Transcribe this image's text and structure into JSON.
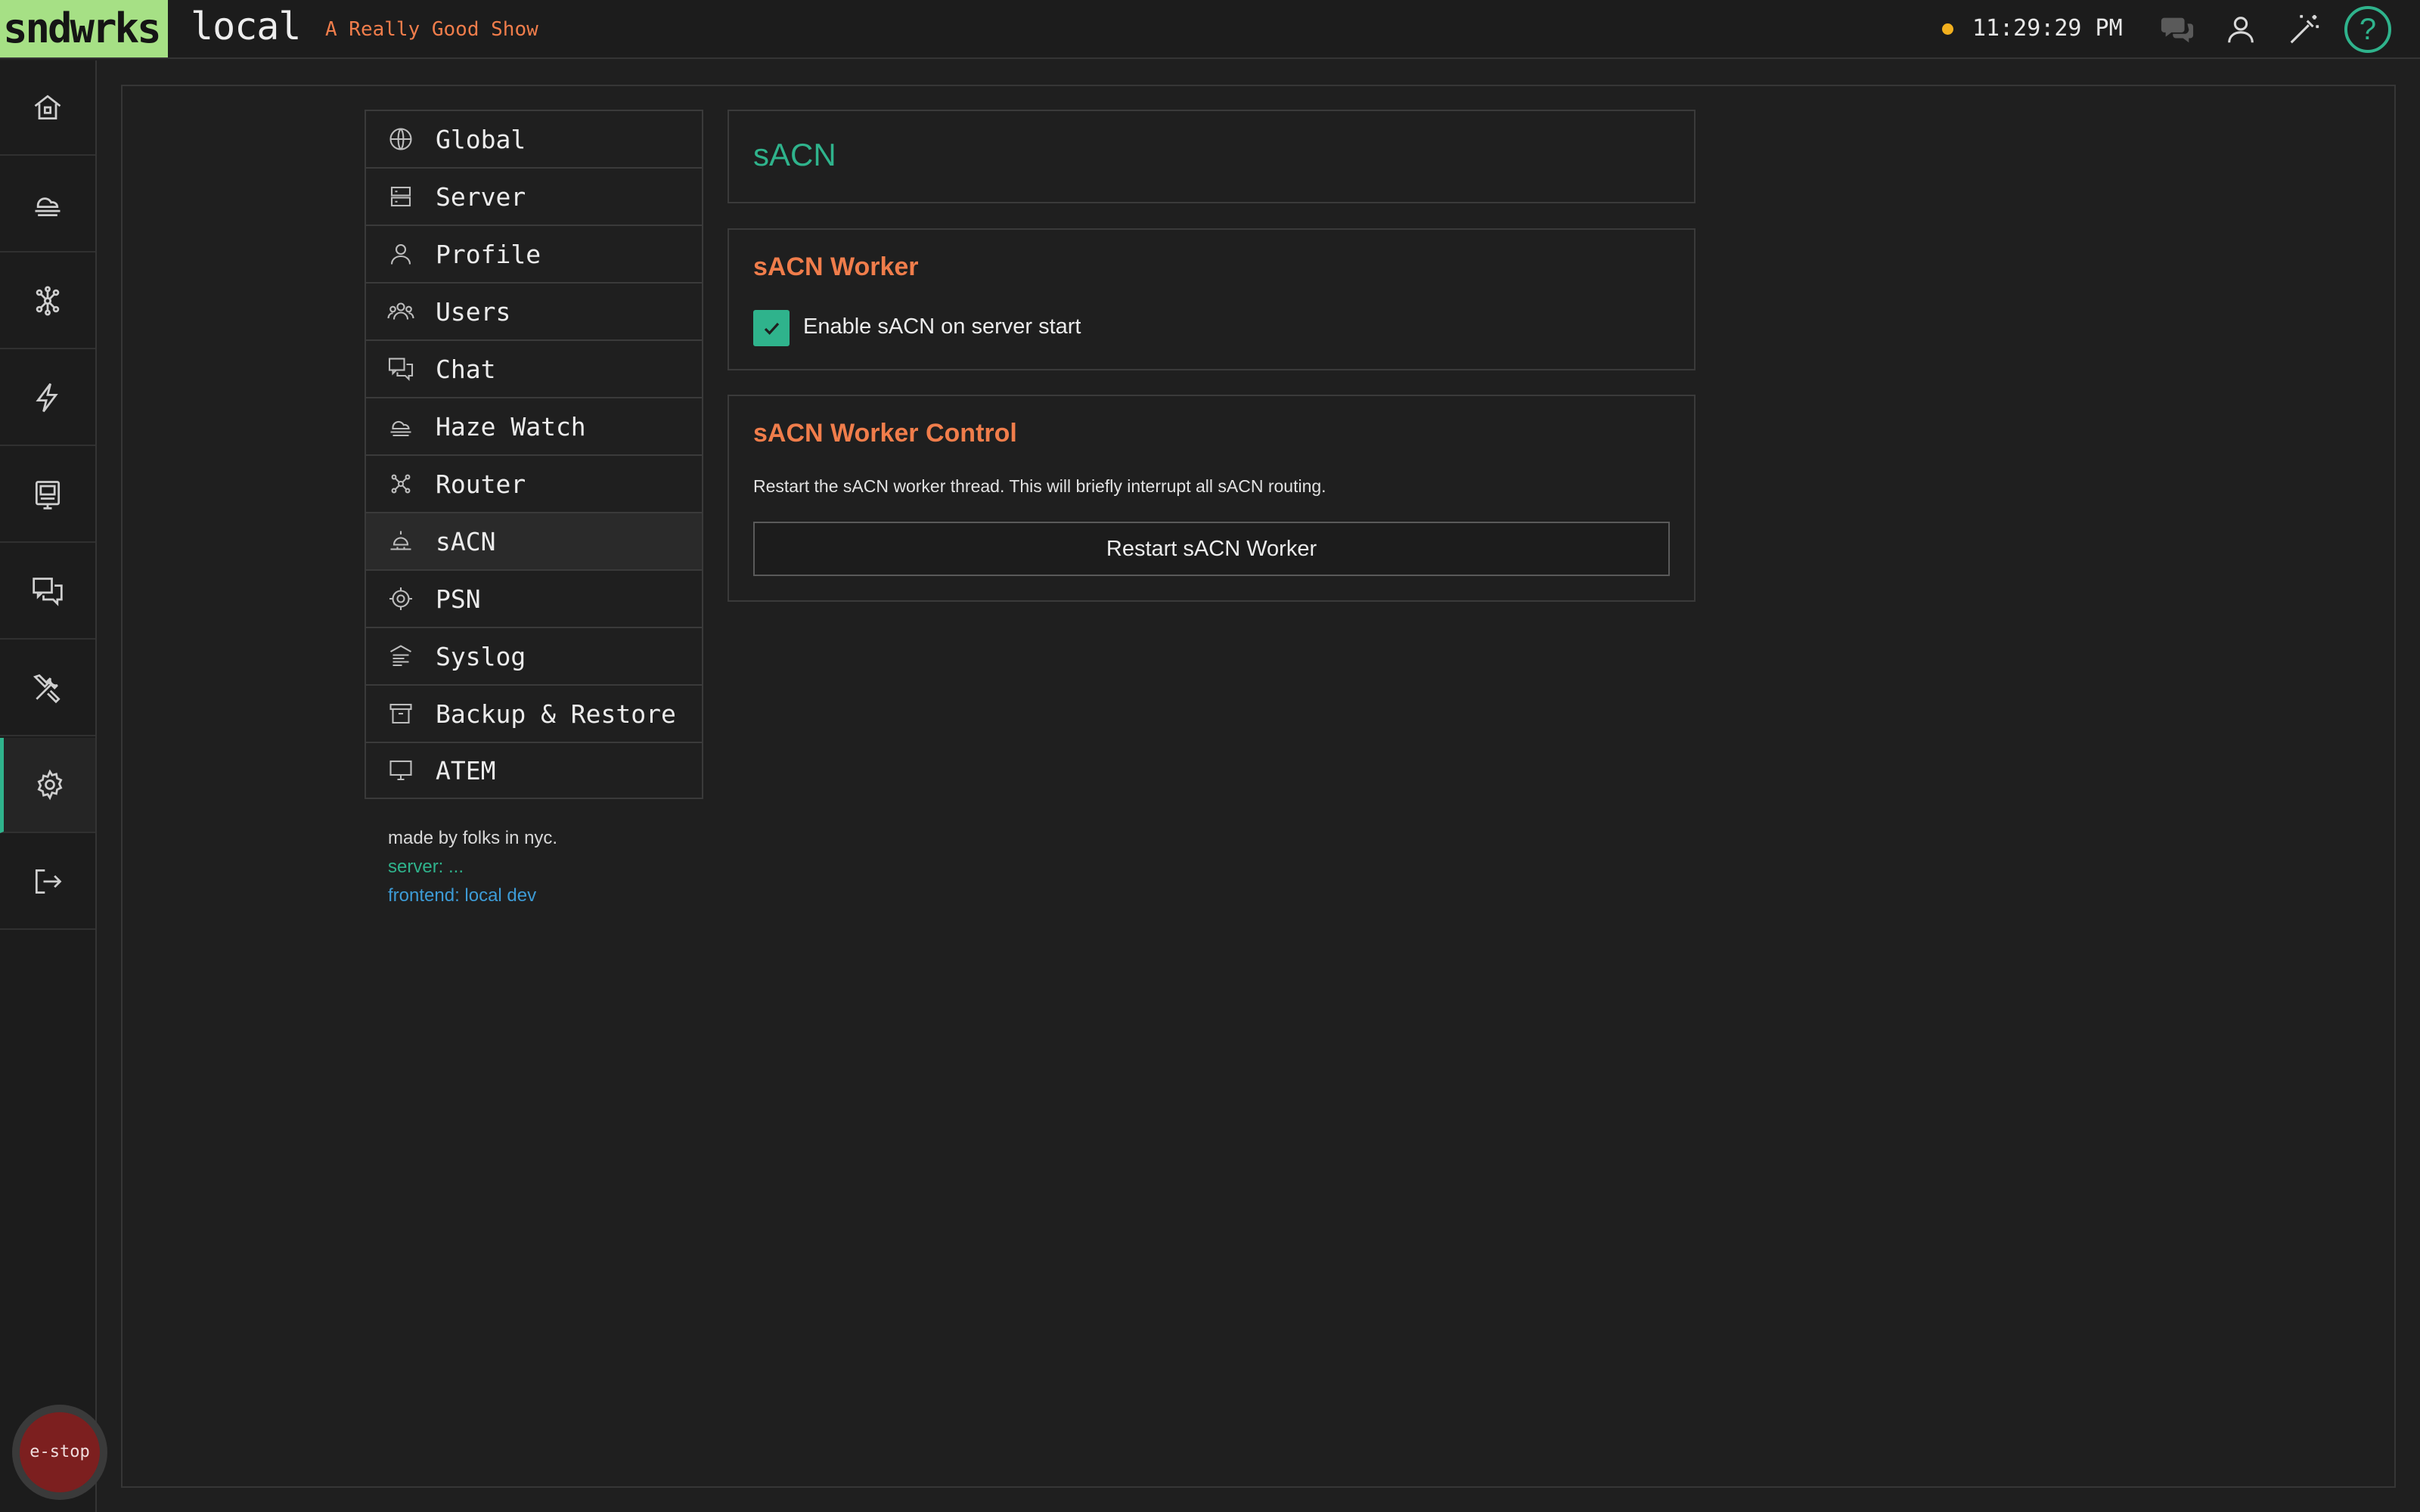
{
  "header": {
    "brand": "sndwrks",
    "app_name": "local",
    "show_name": "A Really Good Show",
    "clock": "11:29:29 PM",
    "status_color": "#f2b01e",
    "icons": [
      "chat-bubbles-icon",
      "user-icon",
      "magic-wand-icon",
      "help-icon"
    ],
    "help_label": "?"
  },
  "rail": {
    "items": [
      "home-icon",
      "haze-icon",
      "router-icon",
      "lightning-icon",
      "display-icon",
      "chat-icon",
      "tools-icon",
      "settings-icon",
      "logout-icon"
    ],
    "active": "settings-icon",
    "estop_label": "e-stop"
  },
  "menu": {
    "items": [
      {
        "label": "Global",
        "icon": "globe-icon"
      },
      {
        "label": "Server",
        "icon": "server-icon"
      },
      {
        "label": "Profile",
        "icon": "user-icon"
      },
      {
        "label": "Users",
        "icon": "users-icon"
      },
      {
        "label": "Chat",
        "icon": "chat-icon"
      },
      {
        "label": "Haze Watch",
        "icon": "haze-icon"
      },
      {
        "label": "Router",
        "icon": "router-icon"
      },
      {
        "label": "sACN",
        "icon": "lamp-icon"
      },
      {
        "label": "PSN",
        "icon": "target-icon"
      },
      {
        "label": "Syslog",
        "icon": "syslog-icon"
      },
      {
        "label": "Backup & Restore",
        "icon": "archive-icon"
      },
      {
        "label": "ATEM",
        "icon": "monitor-icon"
      }
    ],
    "active": "sACN"
  },
  "footer": {
    "made_by": "made by folks in nyc.",
    "server": "server: ...",
    "frontend": "frontend: local dev"
  },
  "content": {
    "title": "sACN",
    "worker": {
      "heading": "sACN Worker",
      "checkbox_label": "Enable sACN on server start",
      "checked": true
    },
    "control": {
      "heading": "sACN Worker Control",
      "description": "Restart the sACN worker thread. This will briefly interrupt all sACN routing.",
      "button_label": "Restart sACN Worker"
    }
  },
  "colors": {
    "accent": "#2fb38c",
    "heading": "#f07d4b",
    "brand_bg": "#a6e085",
    "estop": "#7c1f1f"
  }
}
